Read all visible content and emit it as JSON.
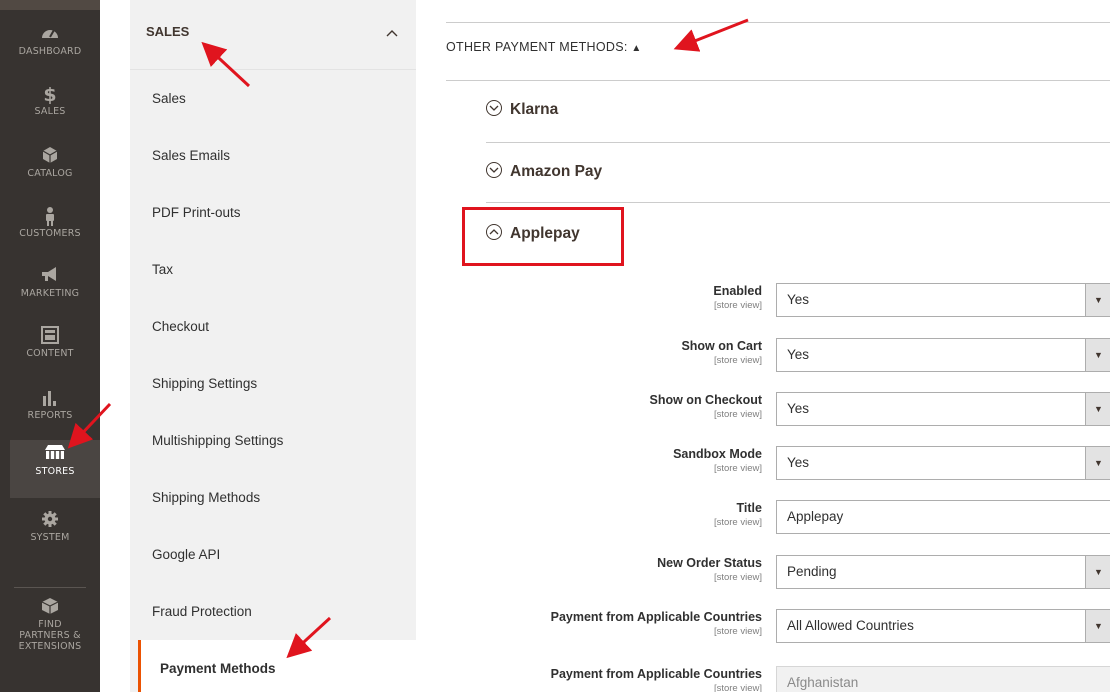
{
  "nav": {
    "items": [
      {
        "label": "DASHBOARD",
        "icon": "dashboard-icon"
      },
      {
        "label": "SALES",
        "icon": "dollar-icon"
      },
      {
        "label": "CATALOG",
        "icon": "cube-icon"
      },
      {
        "label": "CUSTOMERS",
        "icon": "person-icon"
      },
      {
        "label": "MARKETING",
        "icon": "megaphone-icon"
      },
      {
        "label": "CONTENT",
        "icon": "layout-icon"
      },
      {
        "label": "REPORTS",
        "icon": "bar-chart-icon"
      },
      {
        "label": "STORES",
        "icon": "store-icon"
      },
      {
        "label": "SYSTEM",
        "icon": "gear-icon"
      },
      {
        "label": "FIND\nPARTNERS &\nEXTENSIONS",
        "icon": "box-icon"
      }
    ],
    "find_label_1": "FIND",
    "find_label_2": "PARTNERS &",
    "find_label_3": "EXTENSIONS"
  },
  "sidebar": {
    "title": "SALES",
    "items": [
      "Sales",
      "Sales Emails",
      "PDF Print-outs",
      "Tax",
      "Checkout",
      "Shipping Settings",
      "Multishipping Settings",
      "Shipping Methods",
      "Google API",
      "Fraud Protection",
      "Payment Methods"
    ]
  },
  "main": {
    "other_methods": "OTHER PAYMENT METHODS:",
    "other_methods_arrow": "▲",
    "sections": [
      "Klarna",
      "Amazon Pay",
      "Applepay"
    ],
    "scope": "[store view]",
    "fields": [
      {
        "label": "Enabled",
        "value": "Yes",
        "type": "select"
      },
      {
        "label": "Show on Cart",
        "value": "Yes",
        "type": "select"
      },
      {
        "label": "Show on Checkout",
        "value": "Yes",
        "type": "select"
      },
      {
        "label": "Sandbox Mode",
        "value": "Yes",
        "type": "select"
      },
      {
        "label": "Title",
        "value": "Applepay",
        "type": "text"
      },
      {
        "label": "New Order Status",
        "value": "Pending",
        "type": "select"
      },
      {
        "label": "Payment from Applicable Countries",
        "value": "All Allowed Countries",
        "type": "select"
      },
      {
        "label": "Payment from Applicable Countries",
        "value": "Afghanistan",
        "type": "disabled"
      }
    ]
  },
  "colors": {
    "nav_bg": "#373330",
    "accent": "#eb5202",
    "annotation_red": "#e0141e"
  }
}
